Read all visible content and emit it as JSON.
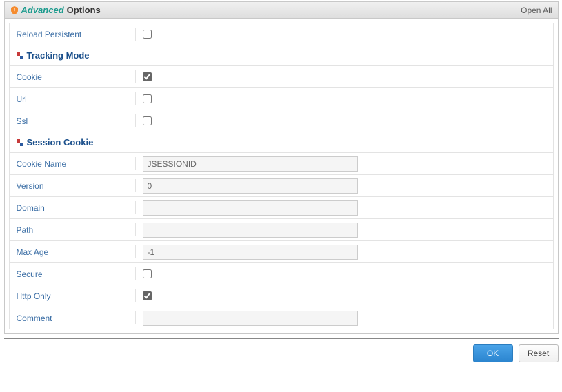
{
  "header": {
    "advanced": "Advanced",
    "options": "Options",
    "open_all": "Open All"
  },
  "fields": {
    "reload_persistent": {
      "label": "Reload Persistent",
      "checked": false
    }
  },
  "tracking_mode": {
    "title": "Tracking Mode",
    "cookie": {
      "label": "Cookie",
      "checked": true
    },
    "url": {
      "label": "Url",
      "checked": false
    },
    "ssl": {
      "label": "Ssl",
      "checked": false
    }
  },
  "session_cookie": {
    "title": "Session Cookie",
    "cookie_name": {
      "label": "Cookie Name",
      "value": "JSESSIONID"
    },
    "version": {
      "label": "Version",
      "value": "0"
    },
    "domain": {
      "label": "Domain",
      "value": ""
    },
    "path": {
      "label": "Path",
      "value": ""
    },
    "max_age": {
      "label": "Max Age",
      "value": "-1"
    },
    "secure": {
      "label": "Secure",
      "checked": false
    },
    "http_only": {
      "label": "Http Only",
      "checked": true
    },
    "comment": {
      "label": "Comment",
      "value": ""
    }
  },
  "footer": {
    "ok": "OK",
    "reset": "Reset"
  }
}
